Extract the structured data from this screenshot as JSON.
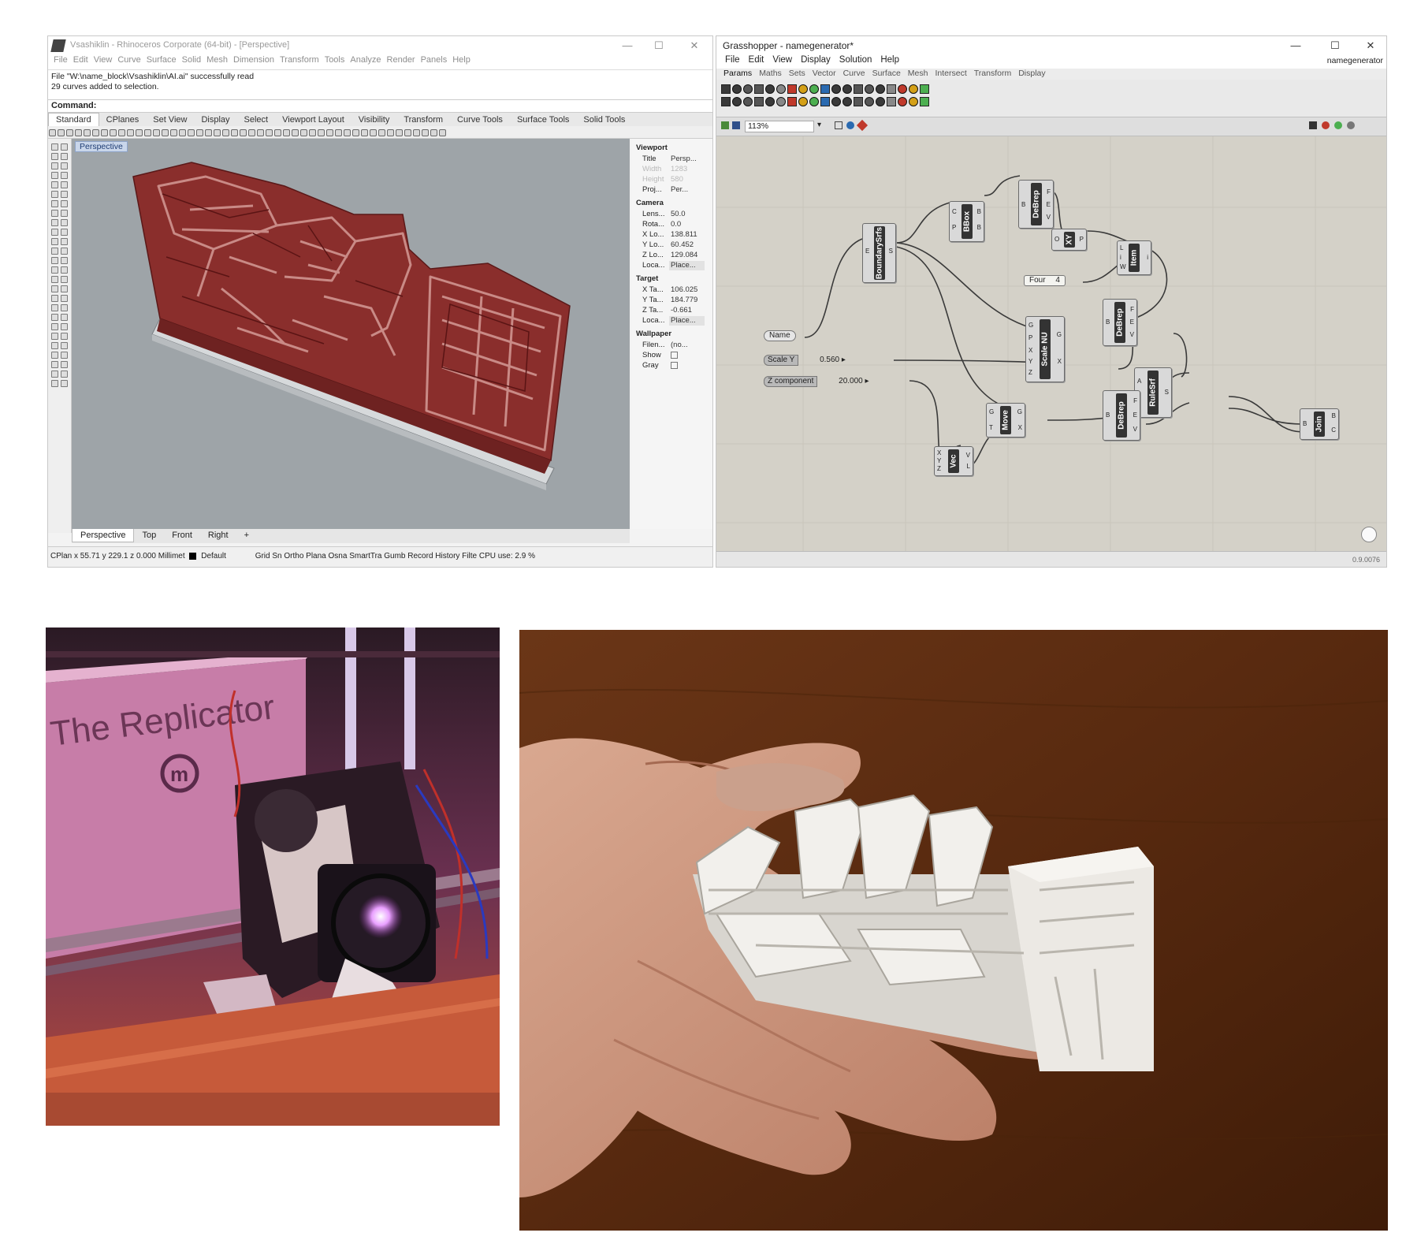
{
  "rhino": {
    "title": "Vsashiklin - Rhinoceros Corporate (64-bit) - [Perspective]",
    "window_controls": [
      "—",
      "☐",
      "✕"
    ],
    "menu": [
      "File",
      "Edit",
      "View",
      "Curve",
      "Surface",
      "Solid",
      "Mesh",
      "Dimension",
      "Transform",
      "Tools",
      "Analyze",
      "Render",
      "Panels",
      "Help"
    ],
    "history": [
      "File \"W:\\name_block\\Vsashiklin\\AI.ai\" successfully read",
      "29 curves added to selection."
    ],
    "command_label": "Command:",
    "toolbar_tabs": [
      "Standard",
      "CPlanes",
      "Set View",
      "Display",
      "Select",
      "Viewport Layout",
      "Visibility",
      "Transform",
      "Curve Tools",
      "Surface Tools",
      "Solid Tools"
    ],
    "viewport_label": "Perspective",
    "properties": {
      "section_viewport": "Viewport",
      "title_label": "Title",
      "title_value": "Persp...",
      "width_label": "Width",
      "width_value": "1283",
      "height_label": "Height",
      "height_value": "580",
      "proj_label": "Proj...",
      "proj_value": "Per...",
      "section_camera": "Camera",
      "lens_label": "Lens...",
      "lens_value": "50.0",
      "rota_label": "Rota...",
      "rota_value": "0.0",
      "xloc_label": "X Lo...",
      "xloc_value": "138.811",
      "yloc_label": "Y Lo...",
      "yloc_value": "60.452",
      "zloc_label": "Z Lo...",
      "zloc_value": "129.084",
      "loca_label": "Loca...",
      "loca_value": "Place...",
      "section_target": "Target",
      "xt_label": "X Ta...",
      "xt_value": "106.025",
      "yt_label": "Y Ta...",
      "yt_value": "184.779",
      "zt_label": "Z Ta...",
      "zt_value": "-0.661",
      "loct_label": "Loca...",
      "loct_value": "Place...",
      "section_wallpaper": "Wallpaper",
      "file_label": "Filen...",
      "file_value": "(no...",
      "show_label": "Show",
      "gray_label": "Gray"
    },
    "view_tabs": [
      "Perspective",
      "Top",
      "Front",
      "Right"
    ],
    "status": {
      "coords": "CPlan x 55.71 y 229.1 z 0.000 Millimet",
      "layer": "Default",
      "toggles": "Grid Sn Ortho Plana Osna SmartTra Gumb Record History Filte CPU use: 2.9 %"
    }
  },
  "grasshopper": {
    "title": "Grasshopper - namegenerator*",
    "window_controls": [
      "—",
      "☐",
      "✕"
    ],
    "doc_name": "namegenerator",
    "menu": [
      "File",
      "Edit",
      "View",
      "Display",
      "Solution",
      "Help"
    ],
    "ribbon": [
      "Params",
      "Maths",
      "Sets",
      "Vector",
      "Curve",
      "Surface",
      "Mesh",
      "Intersect",
      "Transform",
      "Display"
    ],
    "zoom": "113%",
    "version": "0.9.0076",
    "nodes": {
      "boundary": "BoundarySrfs",
      "bbox": "BBox",
      "debrep1": "DeBrep",
      "xy": "XY",
      "item": "Item",
      "scale": "Scale NU",
      "debrep2": "DeBrep",
      "ruled": "RuleSrf",
      "move": "Move",
      "vec": "Vec",
      "debrep3": "DeBrep",
      "join": "Join"
    },
    "params": {
      "name": "Name",
      "four": "Four",
      "four_value": "4",
      "scale_y": "Scale Y",
      "scale_y_value": "0.560",
      "z_comp": "Z component",
      "z_comp_value": "20.000"
    }
  },
  "photo_printer": {
    "brand": "The Replicator",
    "logo": "m"
  },
  "colors": {
    "model_red": "#8a2e2c",
    "viewport_bg": "#9ea4a8",
    "gh_canvas": "#d4d1c8",
    "print_white": "#ece9e4"
  }
}
